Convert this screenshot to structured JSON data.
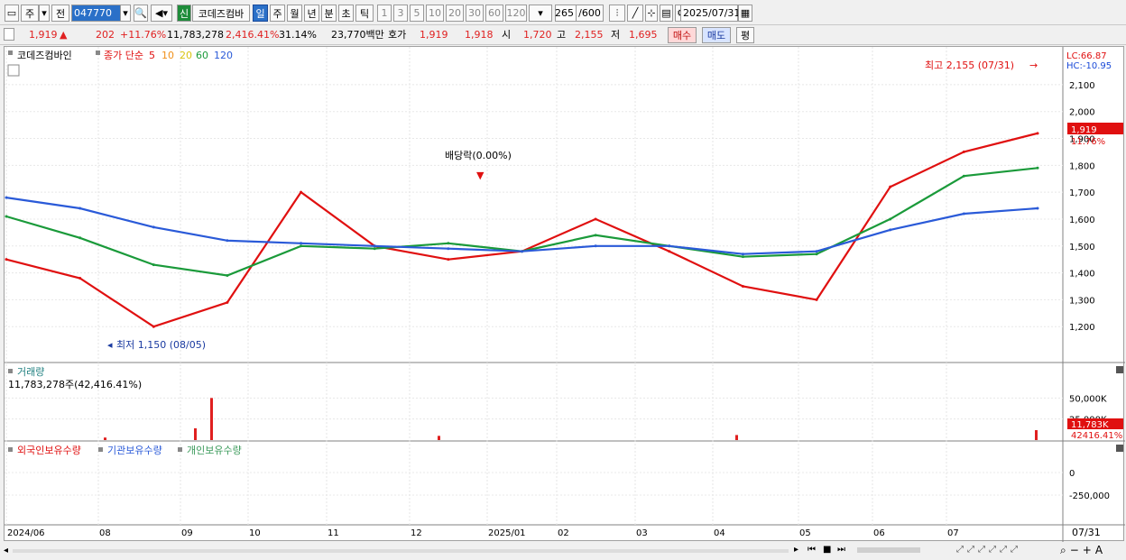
{
  "toolbar": {
    "period_select": "주",
    "compare_label": "전",
    "stock_code": "047770",
    "new_badge": "신",
    "stock_name": "코데즈컴바",
    "timeframes": [
      "일",
      "주",
      "월",
      "년",
      "분",
      "초",
      "틱"
    ],
    "active_timeframe": "일",
    "intervals": [
      "1",
      "3",
      "5",
      "10",
      "20",
      "30",
      "60",
      "120"
    ],
    "count": "265",
    "count_max": "/600",
    "date": "2025/07/31"
  },
  "quote": {
    "price": "1,919",
    "change": "202",
    "change_pct": "+11.76%",
    "volume": "11,783,278",
    "volume_pct": "2,416.41%",
    "turnover_pct": "31.14%",
    "amount": "23,770백만",
    "hoga_label": "호가",
    "ask": "1,919",
    "bid": "1,918",
    "open_label": "시",
    "open": "1,720",
    "high_label": "고",
    "high": "2,155",
    "low_label": "저",
    "low": "1,695",
    "buy_label": "매수",
    "sell_label": "매도",
    "avg_label": "평"
  },
  "price_panel": {
    "name_tag": "코데즈컴바인",
    "ma_label": "종가 단순",
    "ma_periods": [
      "5",
      "10",
      "20",
      "60",
      "120"
    ],
    "lc": "LC:66.87",
    "hc": "HC:-10.95",
    "high_annotation": "최고 2,155 (07/31)",
    "low_annotation": "최저 1,150 (08/05)",
    "dividend_annotation": "배당락(0.00%)",
    "current_price_tag": "1,919",
    "current_pct_tag": "11.76%",
    "y_ticks": [
      "2,100",
      "2,000",
      "1,900",
      "1,800",
      "1,700",
      "1,600",
      "1,500",
      "1,400",
      "1,300",
      "1,200"
    ]
  },
  "volume_panel": {
    "title": "거래량",
    "value_label": "11,783,278주(42,416.41%)",
    "y_ticks": [
      "50,000K",
      "25,000K"
    ],
    "current_tag": "11,783K",
    "current_pct_tag": "42416.41%"
  },
  "holding_panel": {
    "series_labels": [
      "외국인보유수량",
      "기관보유수량",
      "개인보유수량"
    ],
    "y_ticks": [
      "0",
      "-250,000"
    ]
  },
  "x_axis": {
    "labels": [
      "2024/06",
      "08",
      "09",
      "10",
      "11",
      "12",
      "2025/01",
      "02",
      "03",
      "04",
      "05",
      "06",
      "07"
    ],
    "end_label": "07/31"
  },
  "colors": {
    "up": "#e02020",
    "down": "#1a4ad8",
    "ma5": "#e01010",
    "ma10": "#f0901a",
    "ma20": "#f0e020",
    "ma60": "#1a9a3a",
    "ma120": "#2a5ad8",
    "foreign": "#e01010",
    "institution": "#2a5ad8",
    "individual": "#3a9a5a"
  },
  "chart_data": [
    {
      "type": "line",
      "title": "코데즈컴바인",
      "ylim": [
        1100,
        2160
      ],
      "x": [
        "2024/06",
        "07",
        "08",
        "09",
        "10",
        "11",
        "12",
        "2025/01",
        "02",
        "03",
        "04",
        "05",
        "06",
        "07",
        "07/31"
      ],
      "series": [
        {
          "name": "5",
          "values": [
            1450,
            1380,
            1200,
            1290,
            1700,
            1500,
            1450,
            1480,
            1600,
            1480,
            1350,
            1300,
            1720,
            1850,
            1919
          ]
        },
        {
          "name": "60",
          "values": [
            1610,
            1530,
            1430,
            1390,
            1500,
            1490,
            1510,
            1480,
            1540,
            1500,
            1460,
            1470,
            1600,
            1760,
            1790
          ]
        },
        {
          "name": "120",
          "values": [
            1680,
            1640,
            1570,
            1520,
            1510,
            1500,
            1490,
            1480,
            1500,
            1500,
            1470,
            1480,
            1560,
            1620,
            1640
          ]
        }
      ]
    },
    {
      "type": "bar",
      "title": "거래량",
      "ylim": [
        0,
        60000
      ],
      "categories": [
        "08",
        "09",
        "09b",
        "12",
        "04",
        "07/31"
      ],
      "values": [
        3000,
        14000,
        50000,
        5000,
        6000,
        11783
      ]
    }
  ]
}
